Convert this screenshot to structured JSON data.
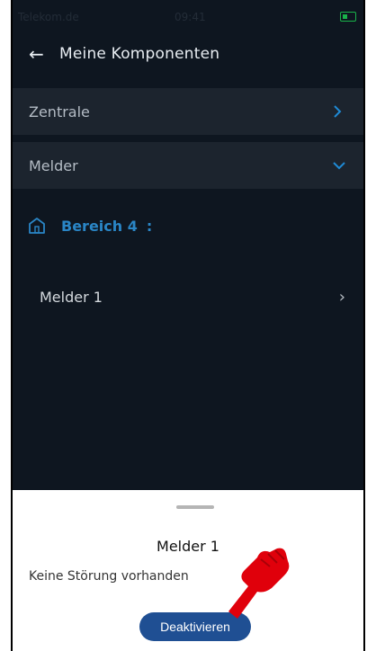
{
  "status_bar": {
    "carrier": "Telekom.de",
    "time": "09:41"
  },
  "app_bar": {
    "title": "Meine Komponenten",
    "back_icon": "arrow-left-icon"
  },
  "sections": [
    {
      "label": "Zentrale",
      "chevron": "chevron-right-icon"
    },
    {
      "label": "Melder",
      "chevron": "chevron-down-icon"
    }
  ],
  "area": {
    "label": "Bereich 4",
    "separator": ":",
    "icon": "home-icon"
  },
  "devices": [
    {
      "label": "Melder 1",
      "arrow": "›"
    }
  ],
  "sheet": {
    "title": "Melder 1",
    "message": "Keine Störung vorhanden",
    "button_label": "Deaktivieren"
  },
  "colors": {
    "background": "#0e1620",
    "section_bg": "#1c242e",
    "accent": "#1f8bd6",
    "button": "#1f4f93",
    "pointer": "#e0000b"
  }
}
